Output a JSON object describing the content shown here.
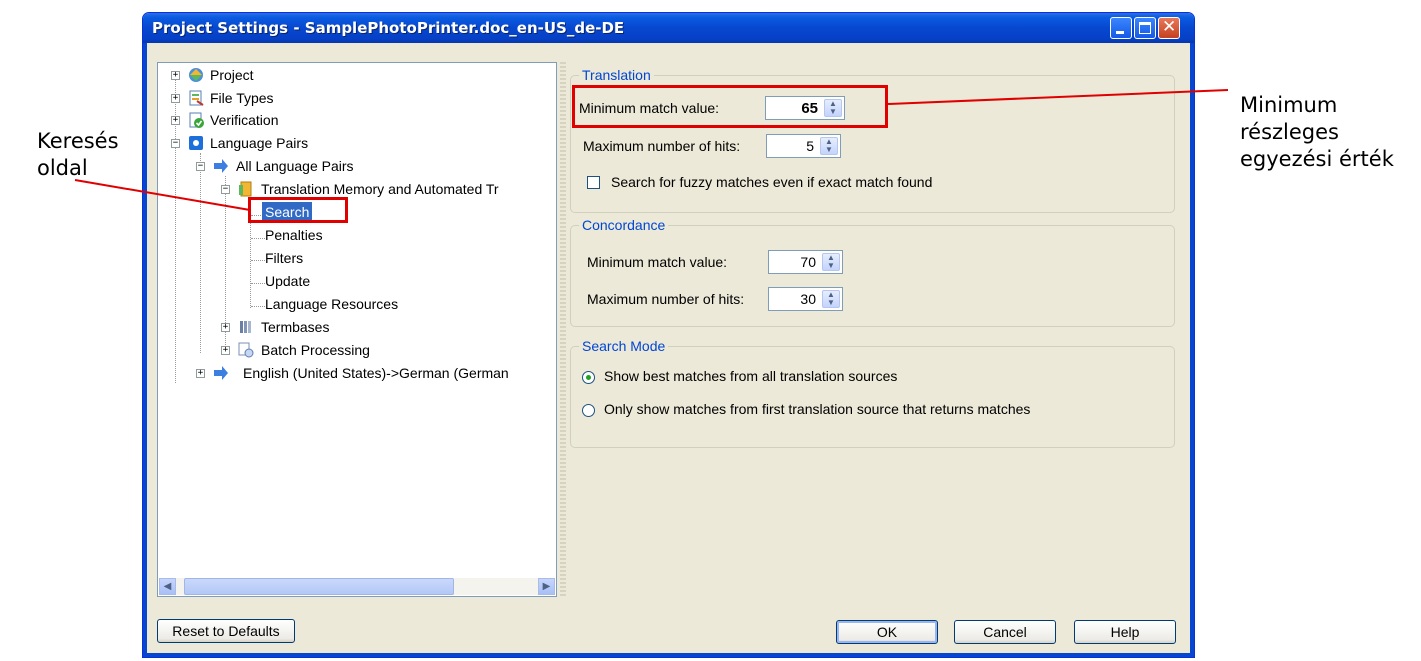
{
  "window": {
    "title": "Project Settings - SamplePhotoPrinter.doc_en-US_de-DE"
  },
  "tree": {
    "items": [
      {
        "label": "Project"
      },
      {
        "label": "File Types"
      },
      {
        "label": "Verification"
      },
      {
        "label": "Language Pairs"
      },
      {
        "label": "All Language Pairs"
      },
      {
        "label": "Translation Memory and Automated Tr"
      },
      {
        "label": "Search"
      },
      {
        "label": "Penalties"
      },
      {
        "label": "Filters"
      },
      {
        "label": "Update"
      },
      {
        "label": "Language Resources"
      },
      {
        "label": "Termbases"
      },
      {
        "label": "Batch Processing"
      },
      {
        "label": "English (United States)->German (German"
      }
    ]
  },
  "translation": {
    "legend": "Translation",
    "min_match_label": "Minimum match value:",
    "min_match_value": "65",
    "max_hits_label": "Maximum number of hits:",
    "max_hits_value": "5",
    "fuzzy_label": "Search for fuzzy matches even if exact match found"
  },
  "concordance": {
    "legend": "Concordance",
    "min_match_label": "Minimum match value:",
    "min_match_value": "70",
    "max_hits_label": "Maximum number of hits:",
    "max_hits_value": "30"
  },
  "search_mode": {
    "legend": "Search Mode",
    "option1": "Show best matches from all translation sources",
    "option2": "Only show matches from first translation source that returns matches"
  },
  "buttons": {
    "reset": "Reset to Defaults",
    "ok": "OK",
    "cancel": "Cancel",
    "help": "Help"
  },
  "annotations": {
    "left_line1": "Keresés",
    "left_line2": "oldal",
    "right_line1": "Minimum",
    "right_line2": "részleges",
    "right_line3": "egyezési érték"
  },
  "colors": {
    "annotation_red": "#e00000",
    "title_blue": "#0747d0",
    "selection": "#316ac5"
  }
}
